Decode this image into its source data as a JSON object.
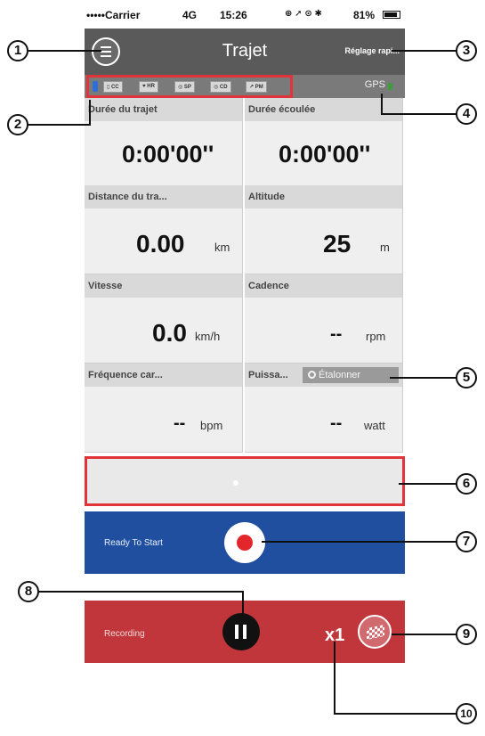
{
  "status_bar": {
    "carrier": "•••••Carrier",
    "network": "4G",
    "time": "15:26",
    "indicators": "⊕ ➚ ⊙ ✱",
    "battery": "81%"
  },
  "nav": {
    "title": "Trajet",
    "right_button": "Réglage rapi...",
    "menu_icon": "menu-icon"
  },
  "sensors": {
    "items": [
      "CC",
      "HR",
      "SP",
      "CD",
      "PM"
    ],
    "gps_label": "GPS"
  },
  "tiles": [
    {
      "label": "Durée du trajet",
      "value": "0:00'00''",
      "unit": ""
    },
    {
      "label": "Durée écoulée",
      "value": "0:00'00''",
      "unit": ""
    },
    {
      "label": "Distance du tra...",
      "value": "0.00",
      "unit": "km"
    },
    {
      "label": "Altitude",
      "value": "25",
      "unit": "m"
    },
    {
      "label": "Vitesse",
      "value": "0.0",
      "unit": "km/h"
    },
    {
      "label": "Cadence",
      "value": "--",
      "unit": "rpm"
    },
    {
      "label": "Fréquence car...",
      "value": "--",
      "unit": "bpm"
    },
    {
      "label": "Puissa...",
      "value": "--",
      "unit": "watt"
    }
  ],
  "calibrate_button": "Étalonner",
  "ready": {
    "label": "Ready To Start"
  },
  "recording": {
    "label": "Recording",
    "speed": "x1"
  },
  "callouts": [
    "1",
    "2",
    "3",
    "4",
    "5",
    "6",
    "7",
    "8",
    "9",
    "10"
  ],
  "colors": {
    "nav": "#5a5a5a",
    "highlight": "#e0343a",
    "ready": "#1f4f9e",
    "recording": "#c1363b"
  }
}
